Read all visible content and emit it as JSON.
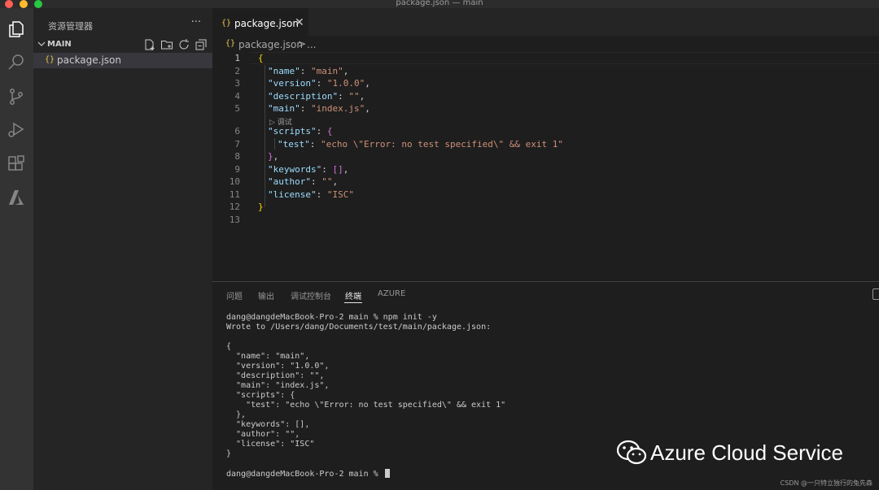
{
  "window": {
    "title": "package.json — main"
  },
  "activity_bar": {
    "items": [
      {
        "icon": "explorer-icon"
      },
      {
        "icon": "search-icon"
      },
      {
        "icon": "source-control-icon"
      },
      {
        "icon": "run-debug-icon"
      },
      {
        "icon": "extensions-icon"
      },
      {
        "icon": "azure-icon"
      }
    ]
  },
  "sidebar": {
    "header": "资源管理器",
    "more": "···",
    "section": "MAIN",
    "file": {
      "icon": "{}",
      "name": "package.json"
    }
  },
  "editor": {
    "tab": {
      "icon": "{}",
      "label": "package.json",
      "close": "✕"
    },
    "breadcrumb": {
      "icon": "{}",
      "file": "package.json",
      "separator": ">",
      "more": "..."
    },
    "codelens": "▷ 调试",
    "line_numbers": [
      "1",
      "2",
      "3",
      "4",
      "5",
      "6",
      "7",
      "8",
      "9",
      "10",
      "11",
      "12",
      "13"
    ],
    "code": {
      "l1": "{",
      "l2_key": "\"name\"",
      "l2_val": "\"main\"",
      "l3_key": "\"version\"",
      "l3_val": "\"1.0.0\"",
      "l4_key": "\"description\"",
      "l4_val": "\"\"",
      "l5_key": "\"main\"",
      "l5_val": "\"index.js\"",
      "l6_key": "\"scripts\"",
      "l6_brace": "{",
      "l7_key": "\"test\"",
      "l7_val": "\"echo \\\"Error: no test specified\\\" && exit 1\"",
      "l8_brace": "}",
      "l9_key": "\"keywords\"",
      "l9_val": "[]",
      "l10_key": "\"author\"",
      "l10_val": "\"\"",
      "l11_key": "\"license\"",
      "l11_val": "\"ISC\"",
      "l12": "}"
    }
  },
  "panel": {
    "tabs": [
      "问题",
      "输出",
      "调试控制台",
      "终端",
      "AZURE"
    ],
    "active_tab": "终端",
    "terminal": "dang@dangdeMacBook-Pro-2 main % npm init -y\nWrote to /Users/dang/Documents/test/main/package.json:\n\n{\n  \"name\": \"main\",\n  \"version\": \"1.0.0\",\n  \"description\": \"\",\n  \"main\": \"index.js\",\n  \"scripts\": {\n    \"test\": \"echo \\\"Error: no test specified\\\" && exit 1\"\n  },\n  \"keywords\": [],\n  \"author\": \"\",\n  \"license\": \"ISC\"\n}\n\n",
    "prompt": "dang@dangdeMacBook-Pro-2 main % "
  },
  "watermark": {
    "text": "Azure Cloud Service",
    "credit": "CSDN @一只特立独行的兔先森"
  },
  "colors": {
    "accent_key": "#9cdcfe",
    "string": "#ce9178",
    "bracket_outer": "#ffd700",
    "bracket_inner": "#da70d6"
  }
}
